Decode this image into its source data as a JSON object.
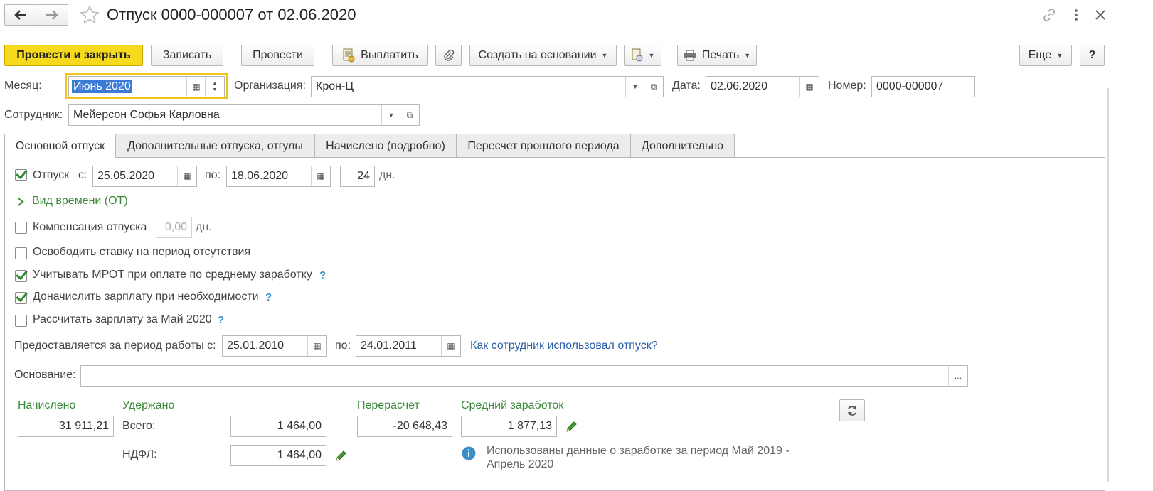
{
  "window": {
    "title": "Отпуск 0000-000007 от 02.06.2020",
    "back_icon": "arrow-left-icon",
    "forward_icon": "arrow-right-icon"
  },
  "toolbar": {
    "post_close": "Провести и закрыть",
    "save": "Записать",
    "post": "Провести",
    "pay": "Выплатить",
    "create_based": "Создать на основании",
    "print": "Печать",
    "more": "Еще",
    "help": "?"
  },
  "header": {
    "month_label": "Месяц:",
    "month_value": "Июнь 2020",
    "org_label": "Организация:",
    "org_value": "Крон-Ц",
    "date_label": "Дата:",
    "date_value": "02.06.2020",
    "number_label": "Номер:",
    "number_value": "0000-000007",
    "employee_label": "Сотрудник:",
    "employee_value": "Мейерсон Софья Карловна"
  },
  "tabs": [
    {
      "label": "Основной отпуск",
      "active": true
    },
    {
      "label": "Дополнительные отпуска, отгулы",
      "active": false
    },
    {
      "label": "Начислено (подробно)",
      "active": false
    },
    {
      "label": "Пересчет прошлого периода",
      "active": false
    },
    {
      "label": "Дополнительно",
      "active": false
    }
  ],
  "vacation": {
    "label": "Отпуск",
    "from_label": "с:",
    "from": "25.05.2020",
    "to_label": "по:",
    "to": "18.06.2020",
    "days": "24",
    "days_unit": "дн.",
    "checked": true
  },
  "time_type": "Вид времени (ОТ)",
  "compensation": {
    "label": "Компенсация отпуска",
    "value": "0,00",
    "unit": "дн.",
    "checked": false
  },
  "options": [
    {
      "label": "Освободить ставку на период отсутствия",
      "checked": false,
      "help": false
    },
    {
      "label": "Учитывать МРОТ при оплате по среднему заработку",
      "checked": true,
      "help": true
    },
    {
      "label": "Доначислить зарплату при необходимости",
      "checked": true,
      "help": true
    },
    {
      "label": "Рассчитать зарплату за Май 2020",
      "checked": false,
      "help": true
    }
  ],
  "work_period": {
    "label": "Предоставляется за период работы с:",
    "from": "25.01.2010",
    "to_label": "по:",
    "to": "24.01.2011",
    "link": "Как сотрудник использовал отпуск?"
  },
  "basis": {
    "label": "Основание:",
    "value": "",
    "button": "..."
  },
  "totals": {
    "accrued_label": "Начислено",
    "accrued": "31 911,21",
    "withheld_label": "Удержано",
    "total_label": "Всего:",
    "total": "1 464,00",
    "ndfl_label": "НДФЛ:",
    "ndfl": "1 464,00",
    "recalc_label": "Перерасчет",
    "recalc": "-20 648,43",
    "avg_label": "Средний заработок",
    "avg": "1 877,13",
    "info_line1": "Использованы данные о заработке за период Май 2019 -",
    "info_line2": "Апрель 2020"
  }
}
